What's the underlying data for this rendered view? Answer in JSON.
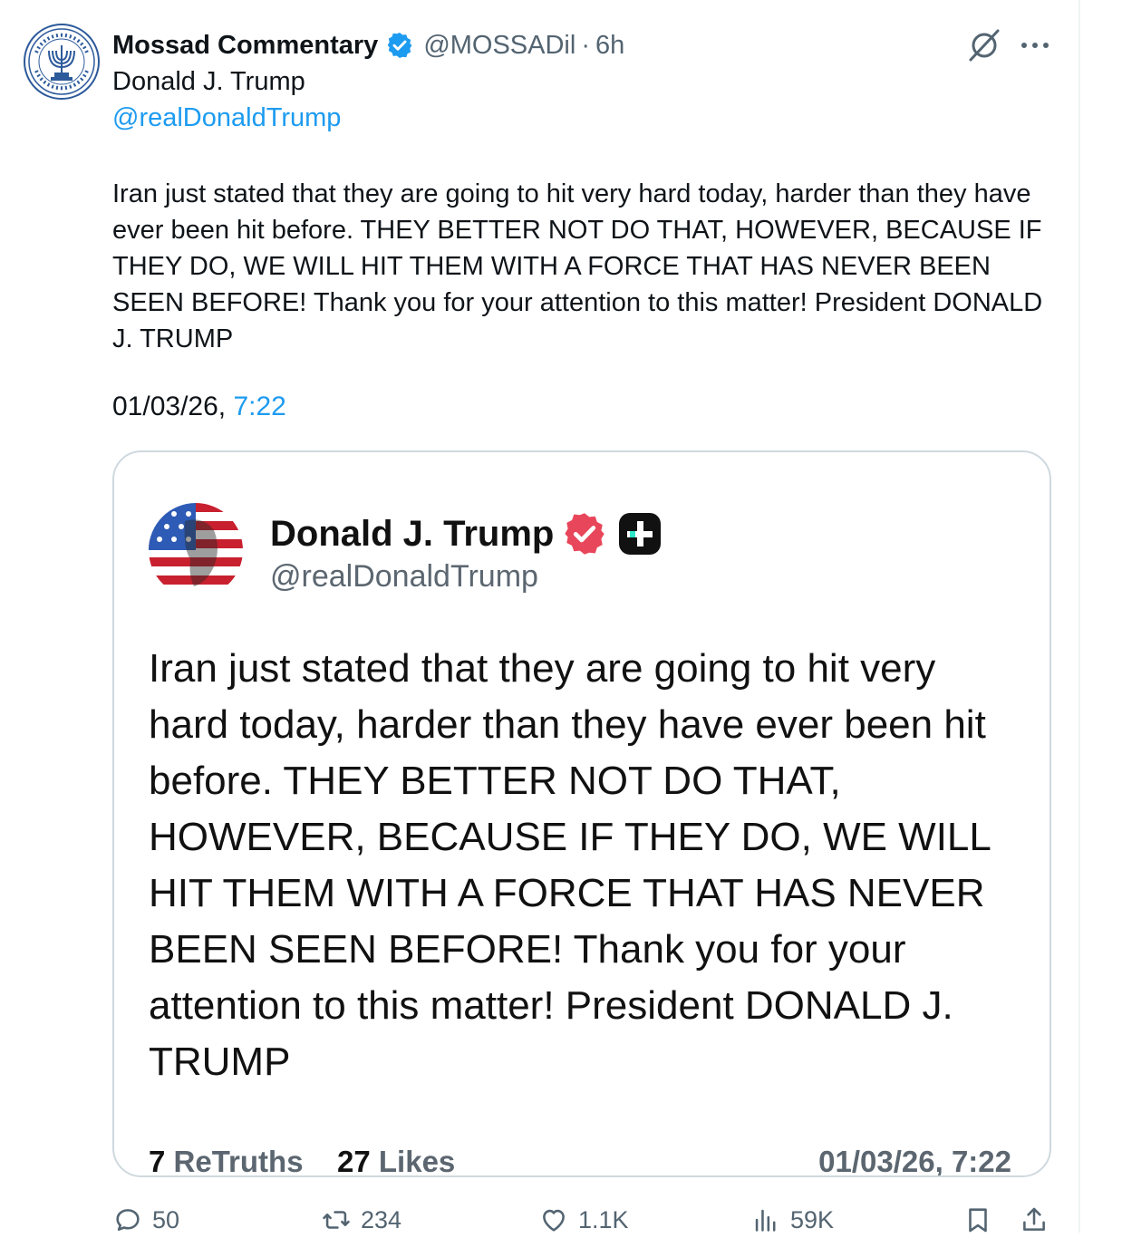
{
  "post": {
    "author_name": "Mossad Commentary",
    "author_handle": "@MOSSADil",
    "separator": "·",
    "time_ago": "6h",
    "quoted_name": "Donald J. Trump",
    "quoted_handle": "@realDonaldTrump",
    "body": "Iran just stated that they are going to hit very hard today, harder than they have ever been hit before. THEY BETTER NOT DO THAT, HOWEVER, BECAUSE IF THEY DO, WE WILL HIT THEM WITH A FORCE THAT HAS NEVER BEEN SEEN BEFORE! Thank you for your attention to this matter! President DONALD J. TRUMP",
    "stamp_date": "01/03/26, ",
    "stamp_time": "7:22"
  },
  "card": {
    "name": "Donald J. Trump",
    "handle": "@realDonaldTrump",
    "text": "Iran just stated that they are going to hit very hard today, harder than they have ever been hit before. THEY BETTER NOT DO THAT, HOWEVER, BECAUSE IF THEY DO, WE WILL HIT THEM WITH A FORCE THAT HAS NEVER BEEN SEEN BEFORE! Thank you for your attention to this matter! President DONALD J. TRUMP",
    "retruths_count": "7",
    "retruths_label": "ReTruths",
    "likes_count": "27",
    "likes_label": "Likes",
    "stamp": "01/03/26, 7:22"
  },
  "actions": {
    "replies": "50",
    "reposts": "234",
    "likes": "1.1K",
    "views": "59K"
  },
  "colors": {
    "accent": "#1d9bf0",
    "secondary_text": "#536471",
    "truth_badge": "#e8465a"
  },
  "icons": {
    "verified": "verified-badge-icon",
    "grok": "grok-icon",
    "more": "more-icon",
    "reply": "reply-icon",
    "repost": "repost-icon",
    "like": "heart-icon",
    "views": "views-icon",
    "bookmark": "bookmark-icon",
    "share": "share-icon"
  }
}
